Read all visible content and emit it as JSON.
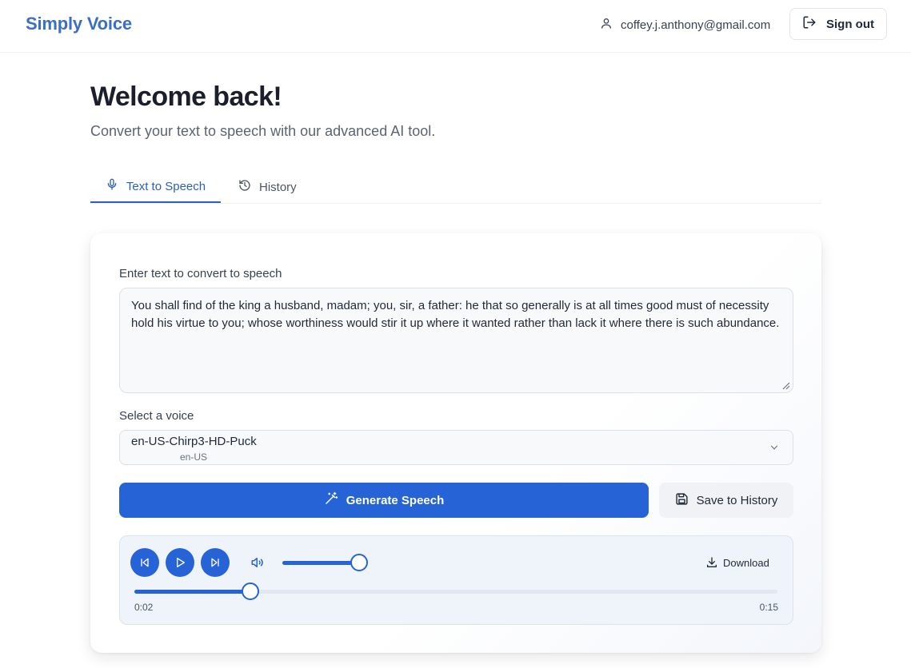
{
  "header": {
    "brand": "Simply Voice",
    "user_email": "coffey.j.anthony@gmail.com",
    "sign_out_label": "Sign out"
  },
  "hero": {
    "title": "Welcome back!",
    "subtitle": "Convert your text to speech with our advanced AI tool."
  },
  "tabs": [
    {
      "label": "Text to Speech",
      "icon": "microphone-icon",
      "active": true
    },
    {
      "label": "History",
      "icon": "history-icon",
      "active": false
    }
  ],
  "form": {
    "text_label": "Enter text to convert to speech",
    "text_value": "You shall find of the king a husband, madam; you, sir, a father: he that so generally is at all times good must of necessity hold his virtue to you; whose worthiness would stir it up where it wanted rather than lack it where there is such abundance.",
    "voice_label": "Select a voice",
    "voice_selected": "en-US-Chirp3-HD-Puck",
    "voice_locale": "en-US",
    "generate_label": "Generate Speech",
    "save_label": "Save to History"
  },
  "player": {
    "download_label": "Download",
    "current_time": "0:02",
    "total_time": "0:15",
    "volume_fraction": 1.0,
    "progress_fraction": 0.18
  },
  "colors": {
    "brand": "#3b6fc4",
    "accent": "#2563d6",
    "player_bg": "#eff4fb"
  }
}
